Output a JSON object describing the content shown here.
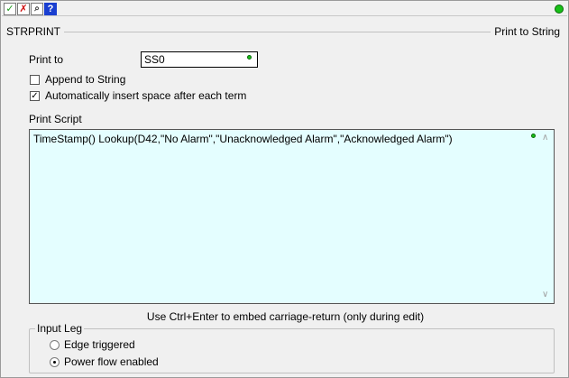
{
  "toolbar": {
    "ok_glyph": "✓",
    "cancel_glyph": "✗",
    "edit_glyph": "⌕",
    "help_glyph": "?"
  },
  "header": {
    "block_name": "STRPRINT",
    "block_description": "Print to String"
  },
  "print_to": {
    "label": "Print to",
    "value": "SS0"
  },
  "options": {
    "append": {
      "label": "Append to String",
      "checked": false
    },
    "auto_space": {
      "label": "Automatically insert space after each term",
      "checked": true,
      "mark": "✓"
    }
  },
  "script": {
    "label": "Print Script",
    "value": "TimeStamp() Lookup(D42,\"No Alarm\",\"Unacknowledged Alarm\",\"Acknowledged Alarm\")",
    "scroll_up": "∧",
    "scroll_down": "∨"
  },
  "hint": "Use Ctrl+Enter to embed carriage-return (only during edit)",
  "input_leg": {
    "title": "Input Leg",
    "options": [
      {
        "label": "Edge triggered",
        "selected": false
      },
      {
        "label": "Power flow enabled",
        "selected": true
      }
    ]
  },
  "colors": {
    "status_ok": "#18c018",
    "script_bg": "#e4feff",
    "help_blue": "#1a3fd0"
  }
}
